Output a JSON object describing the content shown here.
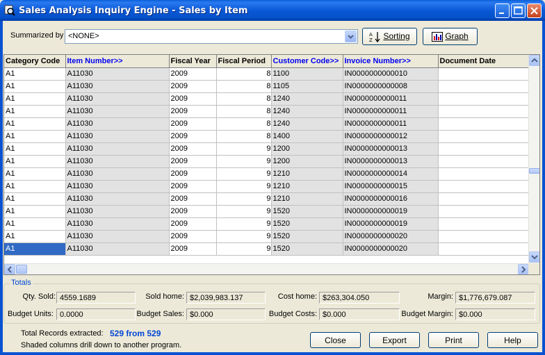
{
  "window": {
    "title": "Sales Analysis Inquiry Engine - Sales by Item"
  },
  "toolbar": {
    "summarized_label": "Summarized by",
    "summarized_value": "<NONE>",
    "sorting_label": "Sorting",
    "graph_label": "Graph"
  },
  "grid": {
    "columns": [
      "Category Code",
      "Item Number>>",
      "Fiscal Year",
      "Fiscal Period",
      "Customer Code>>",
      "Invoice Number>>",
      "Document Date"
    ],
    "rows": [
      {
        "cat": "A1",
        "item": "A11030",
        "year": "2009",
        "period": "8",
        "cust": "1100",
        "inv": "IN0000000000010",
        "date": ""
      },
      {
        "cat": "A1",
        "item": "A11030",
        "year": "2009",
        "period": "8",
        "cust": "1105",
        "inv": "IN0000000000008",
        "date": ""
      },
      {
        "cat": "A1",
        "item": "A11030",
        "year": "2009",
        "period": "8",
        "cust": "1240",
        "inv": "IN0000000000011",
        "date": ""
      },
      {
        "cat": "A1",
        "item": "A11030",
        "year": "2009",
        "period": "8",
        "cust": "1240",
        "inv": "IN0000000000011",
        "date": ""
      },
      {
        "cat": "A1",
        "item": "A11030",
        "year": "2009",
        "period": "8",
        "cust": "1240",
        "inv": "IN0000000000011",
        "date": ""
      },
      {
        "cat": "A1",
        "item": "A11030",
        "year": "2009",
        "period": "8",
        "cust": "1400",
        "inv": "IN0000000000012",
        "date": ""
      },
      {
        "cat": "A1",
        "item": "A11030",
        "year": "2009",
        "period": "9",
        "cust": "1200",
        "inv": "IN0000000000013",
        "date": ""
      },
      {
        "cat": "A1",
        "item": "A11030",
        "year": "2009",
        "period": "9",
        "cust": "1200",
        "inv": "IN0000000000013",
        "date": ""
      },
      {
        "cat": "A1",
        "item": "A11030",
        "year": "2009",
        "period": "9",
        "cust": "1210",
        "inv": "IN0000000000014",
        "date": ""
      },
      {
        "cat": "A1",
        "item": "A11030",
        "year": "2009",
        "period": "9",
        "cust": "1210",
        "inv": "IN0000000000015",
        "date": ""
      },
      {
        "cat": "A1",
        "item": "A11030",
        "year": "2009",
        "period": "9",
        "cust": "1210",
        "inv": "IN0000000000016",
        "date": ""
      },
      {
        "cat": "A1",
        "item": "A11030",
        "year": "2009",
        "period": "9",
        "cust": "1520",
        "inv": "IN0000000000019",
        "date": ""
      },
      {
        "cat": "A1",
        "item": "A11030",
        "year": "2009",
        "period": "9",
        "cust": "1520",
        "inv": "IN0000000000019",
        "date": ""
      },
      {
        "cat": "A1",
        "item": "A11030",
        "year": "2009",
        "period": "9",
        "cust": "1520",
        "inv": "IN0000000000020",
        "date": ""
      },
      {
        "cat": "A1",
        "item": "A11030",
        "year": "2009",
        "period": "9",
        "cust": "1520",
        "inv": "IN0000000000020",
        "date": ""
      }
    ],
    "selected_row": 14
  },
  "totals": {
    "legend": "Totals",
    "qty_sold_label": "Qty. Sold:",
    "qty_sold": "4559.1689",
    "sold_home_label": "Sold home:",
    "sold_home": "$2,039,983.137",
    "cost_home_label": "Cost home:",
    "cost_home": "$263,304.050",
    "margin_label": "Margin:",
    "margin": "$1,776,679.087",
    "budget_units_label": "Budget Units:",
    "budget_units": "0.0000",
    "budget_sales_label": "Budget Sales:",
    "budget_sales": "$0.000",
    "budget_costs_label": "Budget Costs:",
    "budget_costs": "$0.000",
    "budget_margin_label": "Budget Margin:",
    "budget_margin": "$0.000"
  },
  "footer": {
    "records_label": "Total Records extracted:",
    "records_value": "529 from 529",
    "note": "Shaded columns drill down to another program.",
    "close_label": "Close",
    "export_label": "Export",
    "print_label": "Print",
    "help_label": "Help"
  },
  "colors": {
    "title_bar": "#0a58d6",
    "link_header": "#0000ee",
    "selection": "#316ac5",
    "shaded_column": "#e2e2e2"
  }
}
